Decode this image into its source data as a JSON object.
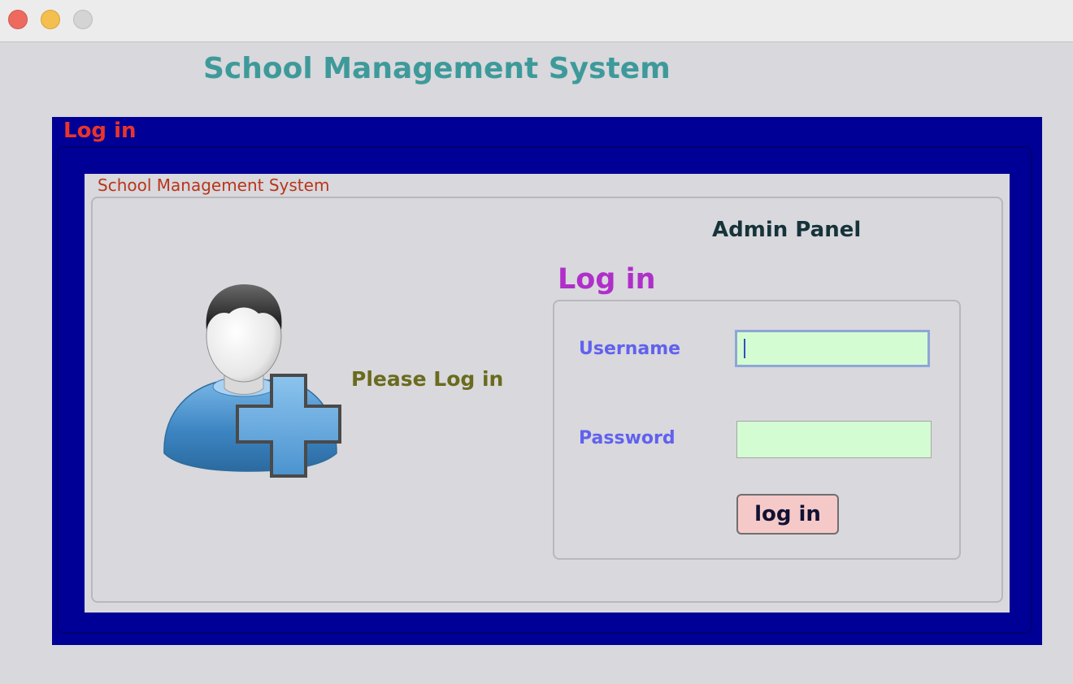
{
  "window": {
    "controls": [
      "close",
      "minimize",
      "maximize"
    ]
  },
  "app": {
    "title": "School Management System"
  },
  "outer_panel": {
    "title": "Log in"
  },
  "content_panel": {
    "legend": "School Management System",
    "prompt": "Please Log in",
    "admin_title": "Admin Panel",
    "avatar_icon": "user-add-icon"
  },
  "login_form": {
    "heading": "Log in",
    "username_label": "Username",
    "username_value": "",
    "password_label": "Password",
    "password_value": "",
    "submit_label": "log in"
  },
  "colors": {
    "frame": "#000096",
    "input_bg": "#d4fcd2",
    "button_bg": "#f6c9c9",
    "title": "#3e9a9a"
  }
}
